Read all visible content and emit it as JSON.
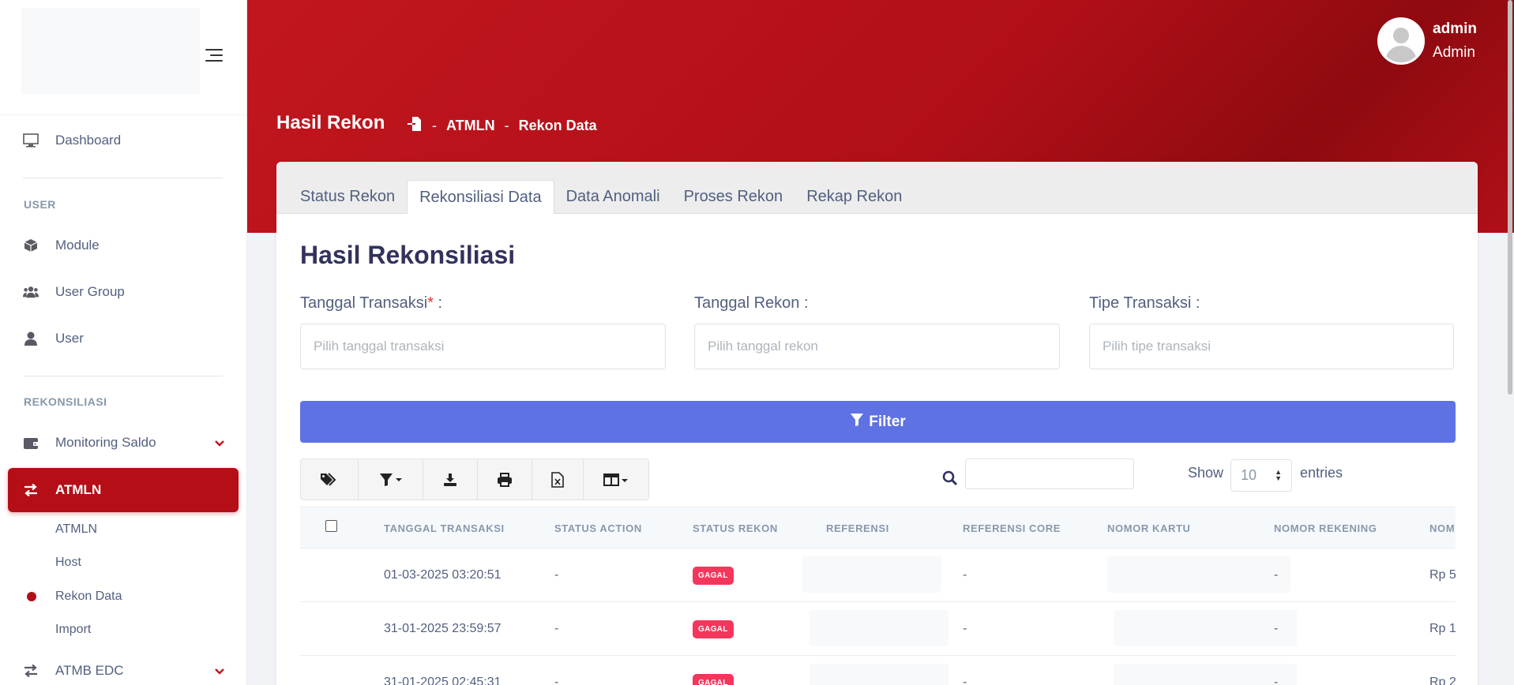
{
  "sidebar": {
    "items": {
      "dashboard": "Dashboard",
      "module": "Module",
      "user_group": "User Group",
      "user": "User",
      "monitoring_saldo": "Monitoring Saldo",
      "atmln": "ATMLN",
      "atmb_edc": "ATMB EDC"
    },
    "sections": {
      "user": "USER",
      "rekonsiliasi": "REKONSILIASI"
    },
    "sub_items": [
      "ATMLN",
      "Host",
      "Rekon Data",
      "Import"
    ]
  },
  "header": {
    "user_name": "admin",
    "user_role": "Admin",
    "page_title": "Hasil Rekon",
    "breadcrumb": [
      "ATMLN",
      "Rekon Data"
    ],
    "breadcrumb_sep": "-"
  },
  "tabs": [
    "Status Rekon",
    "Rekonsiliasi Data",
    "Data Anomali",
    "Proses Rekon",
    "Rekap Rekon"
  ],
  "active_tab": "Rekonsiliasi Data",
  "main": {
    "title": "Hasil Rekonsiliasi",
    "fields": {
      "tanggal_transaksi": {
        "label": "Tanggal Transaksi",
        "required_mark": "*",
        "suffix": " :",
        "placeholder": "Pilih tanggal transaksi"
      },
      "tanggal_rekon": {
        "label": "Tanggal Rekon :",
        "placeholder": "Pilih tanggal rekon"
      },
      "tipe_transaksi": {
        "label": "Tipe Transaksi :",
        "placeholder": "Pilih tipe transaksi"
      }
    },
    "filter_label": "Filter",
    "show_label": "Show",
    "entries_value": "10",
    "entries_label": "entries"
  },
  "table": {
    "columns": [
      "TANGGAL TRANSAKSI",
      "STATUS ACTION",
      "STATUS REKON",
      "REFERENSI",
      "REFERENSI CORE",
      "NOMOR KARTU",
      "NOMOR REKENING",
      "NOM"
    ],
    "rows": [
      {
        "tanggal": "01-03-2025 03:20:51",
        "status_action": "-",
        "status_rekon": "GAGAL",
        "referensi_core": "-",
        "nomor_rekening": "-",
        "nominal": "Rp 5"
      },
      {
        "tanggal": "31-01-2025 23:59:57",
        "status_action": "-",
        "status_rekon": "GAGAL",
        "referensi_core": "-",
        "nomor_rekening": "-",
        "nominal": "Rp 1"
      },
      {
        "tanggal": "31-01-2025 02:45:31",
        "status_action": "-",
        "status_rekon": "GAGAL",
        "referensi_core": "-",
        "nomor_rekening": "-",
        "nominal": "Rp 2"
      }
    ]
  },
  "colors": {
    "brand_red": "#b50e17",
    "primary": "#5e72e4",
    "badge_danger": "#f5365c"
  },
  "icons": {
    "toolbar": [
      "tags-icon",
      "filter-dropdown-icon",
      "download-icon",
      "print-icon",
      "excel-file-icon",
      "columns-dropdown-icon"
    ]
  }
}
